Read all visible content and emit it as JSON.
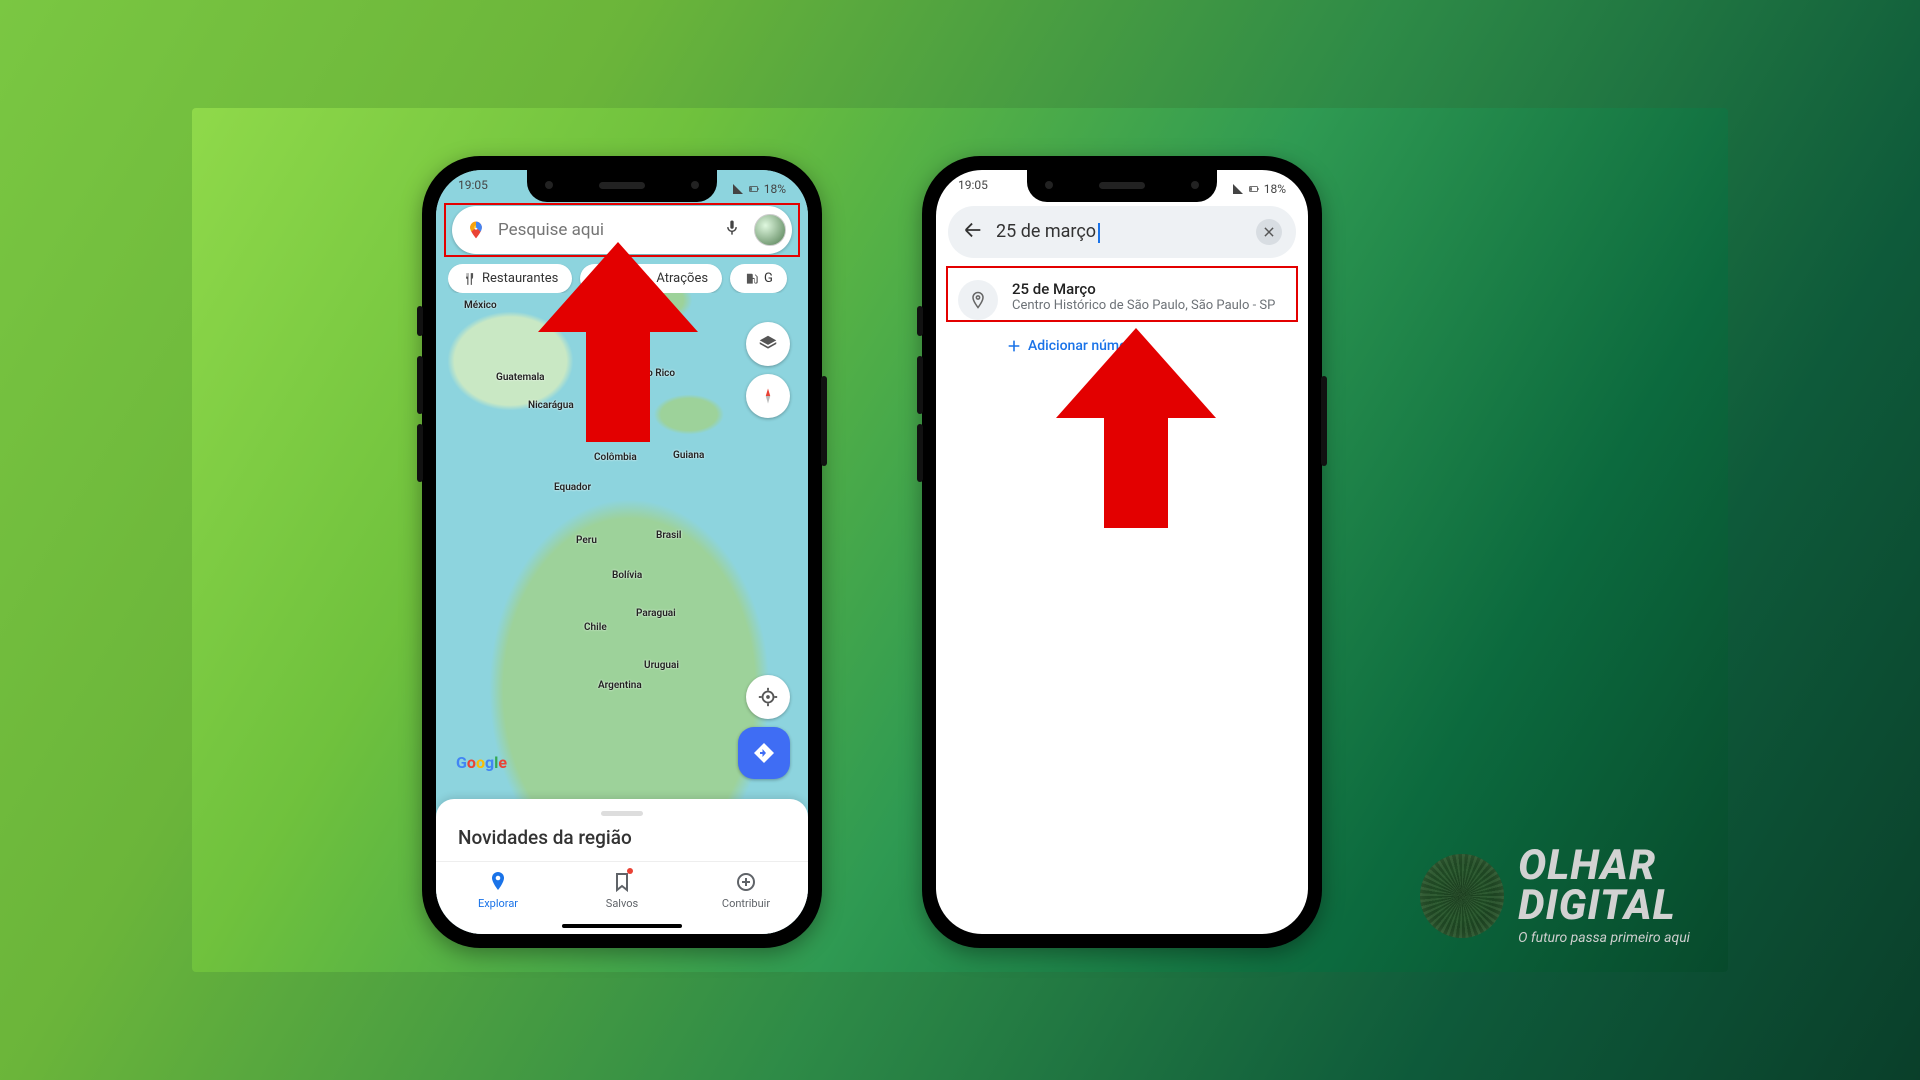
{
  "statusbar": {
    "time": "19:05",
    "battery": "18%"
  },
  "phone1": {
    "search_placeholder": "Pesquise aqui",
    "chips": {
      "restaurants": "Restaurantes",
      "attractions": "Atrações",
      "gas": "G"
    },
    "sheet_title": "Novidades da região",
    "tabs": {
      "explore": "Explorar",
      "saved": "Salvos",
      "contribute": "Contribuir"
    },
    "map_labels": {
      "mexico": "México",
      "guatemala": "Guatemala",
      "nicaragua": "Nicarágua",
      "porto_rico": "Porto Rico",
      "colombia": "Colômbia",
      "guiana": "Guiana",
      "equador": "Equador",
      "peru": "Peru",
      "brasil": "Brasil",
      "bolivia": "Bolívia",
      "paraguai": "Paraguai",
      "chile": "Chile",
      "uruguai": "Uruguai",
      "argentina": "Argentina"
    }
  },
  "phone2": {
    "search_query": "25 de março",
    "result_title": "25 de Março",
    "result_subtitle": "Centro Histórico de São Paulo, São Paulo - SP",
    "add_number": "Adicionar número"
  },
  "brand": {
    "line1": "OLHAR",
    "line2": "DIGITAL",
    "tagline": "O futuro passa primeiro aqui"
  },
  "colors": {
    "accent": "#1a73e8",
    "highlight": "#e30000"
  }
}
